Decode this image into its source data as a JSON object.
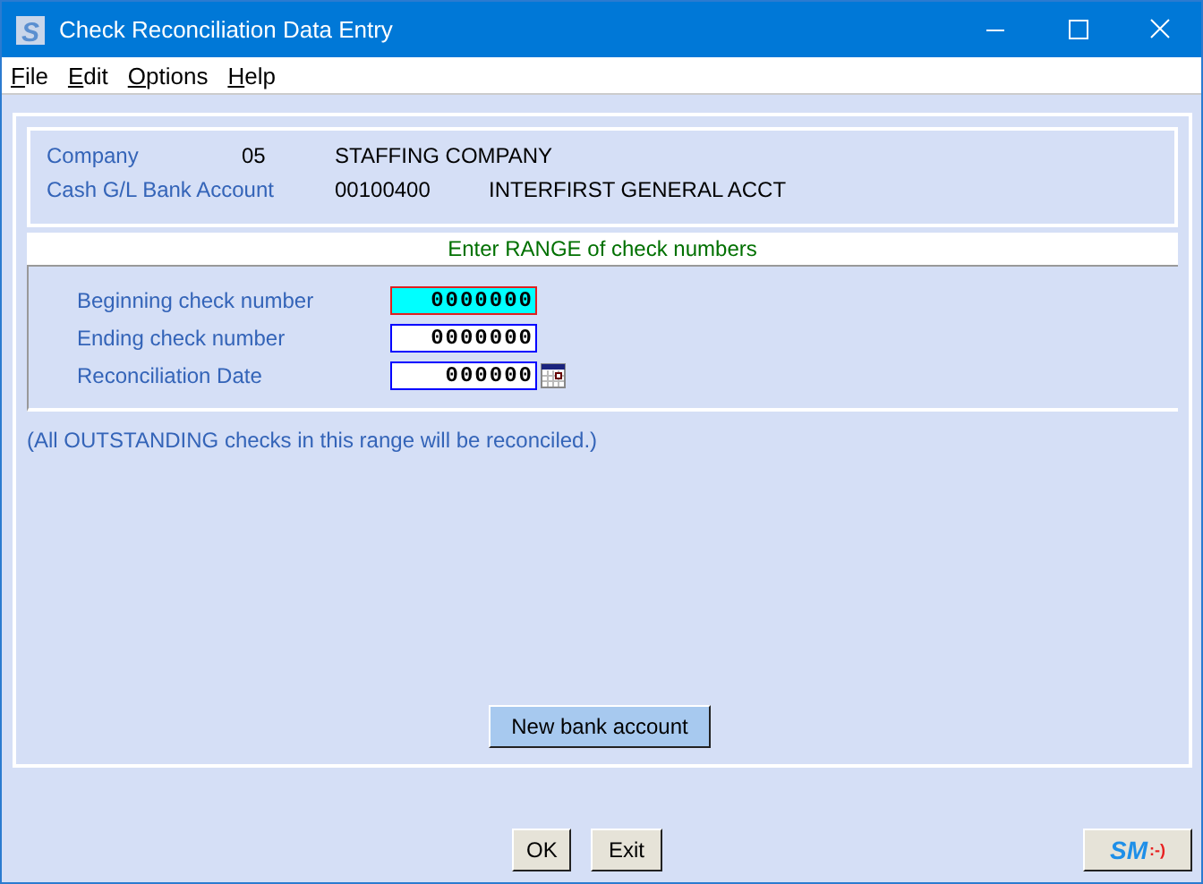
{
  "window": {
    "title": "Check Reconciliation Data Entry",
    "logo_letter": "S"
  },
  "menu": [
    "File",
    "Edit",
    "Options",
    "Help"
  ],
  "header": [
    {
      "label": "Company",
      "code": "05",
      "name": "STAFFING COMPANY"
    },
    {
      "label": "Cash G/L Bank Account",
      "code": "00100400",
      "name": "INTERFIRST GENERAL ACCT"
    }
  ],
  "range_title": "Enter RANGE of check numbers",
  "fields": [
    {
      "label": "Beginning check number",
      "value": "0000000",
      "focused": true,
      "kind": "number"
    },
    {
      "label": "Ending check number",
      "value": "0000000",
      "focused": false,
      "kind": "number"
    },
    {
      "label": "Reconciliation Date",
      "value": "000000",
      "focused": false,
      "kind": "date"
    }
  ],
  "note": "(All OUTSTANDING checks in this range will be reconciled.)",
  "new_account_button": "New bank account",
  "buttons": [
    "OK",
    "Exit"
  ],
  "logo_button": {
    "letters": "SM",
    "smiley": ":-)"
  }
}
